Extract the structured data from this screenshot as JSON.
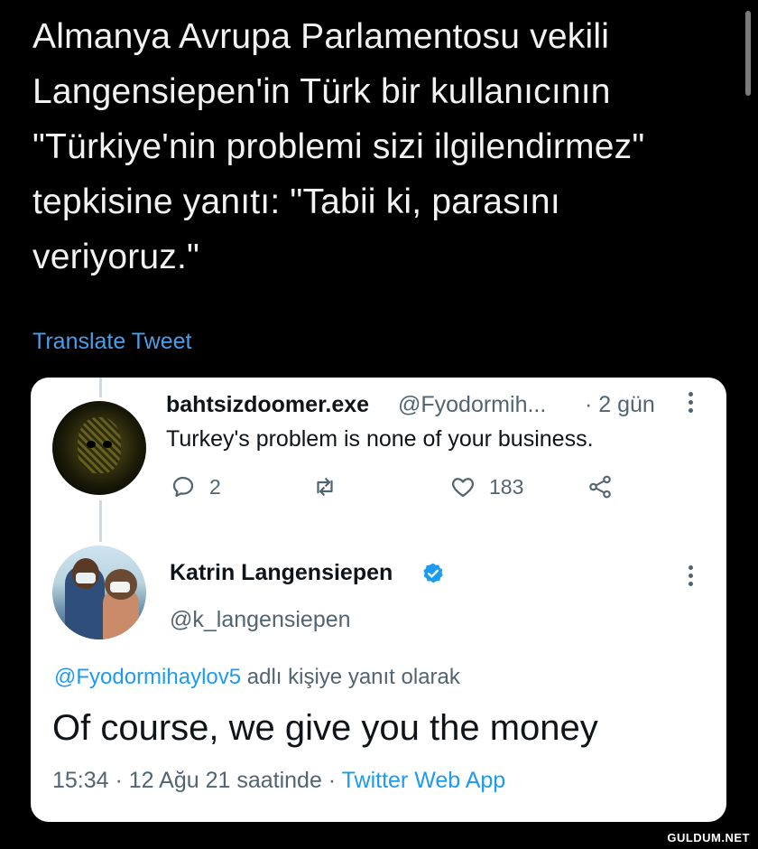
{
  "headline": {
    "lines": [
      "Almanya Avrupa Parlamentosu vekili",
      "Langensiepen'in Türk bir kullanıcının",
      "\"Türkiye'nin problemi sizi ilgilendirmez\"",
      "tepkisine yanıtı: \"Tabii ki, parasını",
      "veriyoruz.\""
    ]
  },
  "translate_label": "Translate Tweet",
  "tweet1": {
    "display_name": "bahtsizdoomer.exe",
    "handle": "@Fyodormih...",
    "time": "· 2 gün",
    "text": "Turkey's problem is none of your business.",
    "reply_count": "2",
    "like_count": "183",
    "avatar_icon": "skull-avatar"
  },
  "tweet2": {
    "display_name": "Katrin Langensiepen",
    "handle": "@k_langensiepen",
    "verified_icon": "verified-badge-icon",
    "reply_prefix_mention": "@Fyodormihaylov5",
    "reply_prefix_rest": " adlı kişiye yanıt olarak",
    "text": "Of course, we give you the money",
    "timestamp": "15:34 · 12 Ağu 21 saatinde · ",
    "app": "Twitter Web App"
  },
  "colors": {
    "background": "#000000",
    "card": "#ffffff",
    "link_blue": "#1d9bf0",
    "translate_blue": "#4a9ee8",
    "muted_text": "#536471"
  },
  "watermark": "GULDUM.NET"
}
